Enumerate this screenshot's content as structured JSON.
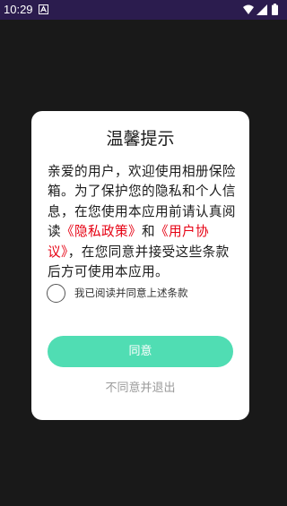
{
  "status_bar": {
    "time": "10:29",
    "notification_icon": "a-notification-icon",
    "wifi_icon": "wifi-icon",
    "signal_icon": "signal-icon",
    "battery_icon": "battery-icon",
    "background_color": "#2b1c4e"
  },
  "dialog": {
    "title": "温馨提示",
    "body": {
      "text_1": "亲爱的用户，欢迎使用相册保险箱。为了保护您的隐私和个人信息，在您使用本应用前请认真阅读",
      "privacy_link": "《隐私政策》",
      "text_and": "和",
      "user_agreement_link": "《用户协议》",
      "text_2": "，在您同意并接受这些条款后方可使用本应用。"
    },
    "agree_checkbox_label": "我已阅读并同意上述条款",
    "agree_checked": false,
    "agree_button": "同意",
    "exit_button": "不同意并退出"
  },
  "colors": {
    "accent": "#50ddb3",
    "link": "#e60012",
    "overlay": "#191919"
  }
}
